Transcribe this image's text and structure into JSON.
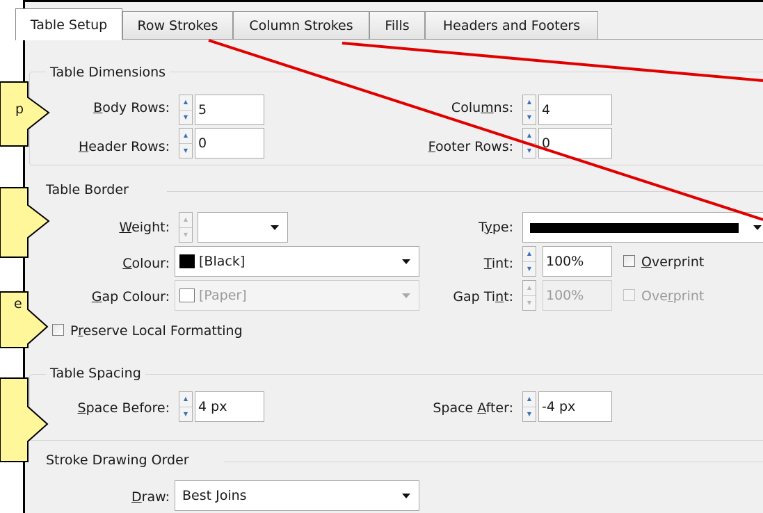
{
  "tabs": [
    {
      "label": "Table Setup",
      "active": true
    },
    {
      "label": "Row Strokes",
      "active": false
    },
    {
      "label": "Column Strokes",
      "active": false
    },
    {
      "label": "Fills",
      "active": false
    },
    {
      "label": "Headers and Footers",
      "active": false
    }
  ],
  "dimensions": {
    "title": "Table Dimensions",
    "body_rows": {
      "pre": "",
      "key": "B",
      "post": "ody Rows:",
      "value": "5"
    },
    "header_rows": {
      "pre": "",
      "key": "H",
      "post": "eader Rows:",
      "value": "0"
    },
    "columns": {
      "pre": "Colu",
      "key": "m",
      "post": "ns:",
      "value": "4"
    },
    "footer_rows": {
      "pre": "",
      "key": "F",
      "post": "ooter Rows:",
      "value": "0"
    }
  },
  "border": {
    "title": "Table Border",
    "weight": {
      "pre": "",
      "key": "W",
      "post": "eight:",
      "value": ""
    },
    "type": {
      "pre": "T",
      "key": "y",
      "post": "pe:"
    },
    "colour": {
      "pre": "",
      "key": "C",
      "post": "olour:",
      "value": "[Black]",
      "swatch": "#000000"
    },
    "tint": {
      "pre": "",
      "key": "T",
      "post": "int:",
      "value": "100%"
    },
    "overprint": {
      "pre": "",
      "key": "O",
      "post": "verprint",
      "checked": false
    },
    "gap_colour": {
      "pre": "",
      "key": "G",
      "post": "ap Colour:",
      "value": "[Paper]",
      "swatch": "#ffffff"
    },
    "gap_tint": {
      "pre": "Gap Ti",
      "key": "n",
      "post": "t:",
      "value": "100%"
    },
    "gap_overprint": {
      "pre": "Ove",
      "key": "r",
      "post": "print",
      "checked": false
    }
  },
  "preserve": {
    "pre": "P",
    "key": "r",
    "post": "eserve Local Formatting",
    "checked": false
  },
  "spacing": {
    "title": "Table Spacing",
    "before": {
      "pre": "",
      "key": "S",
      "post": "pace Before:",
      "value": "4 px"
    },
    "after": {
      "pre": "Space ",
      "key": "A",
      "post": "fter:",
      "value": "-4 px"
    }
  },
  "stroke_order": {
    "title": "Stroke Drawing Order",
    "draw": {
      "pre": "",
      "key": "D",
      "post": "raw:",
      "value": "Best Joins"
    }
  },
  "callouts": [
    {
      "text": "p"
    },
    {
      "text": ""
    },
    {
      "text": "e"
    },
    {
      "text": ""
    }
  ],
  "colors": {
    "callout_fill": "#fff799",
    "callout_border": "#000000",
    "annotation_line": "#e00000"
  },
  "icons": {
    "spin_up": "▲",
    "spin_down": "▼"
  }
}
